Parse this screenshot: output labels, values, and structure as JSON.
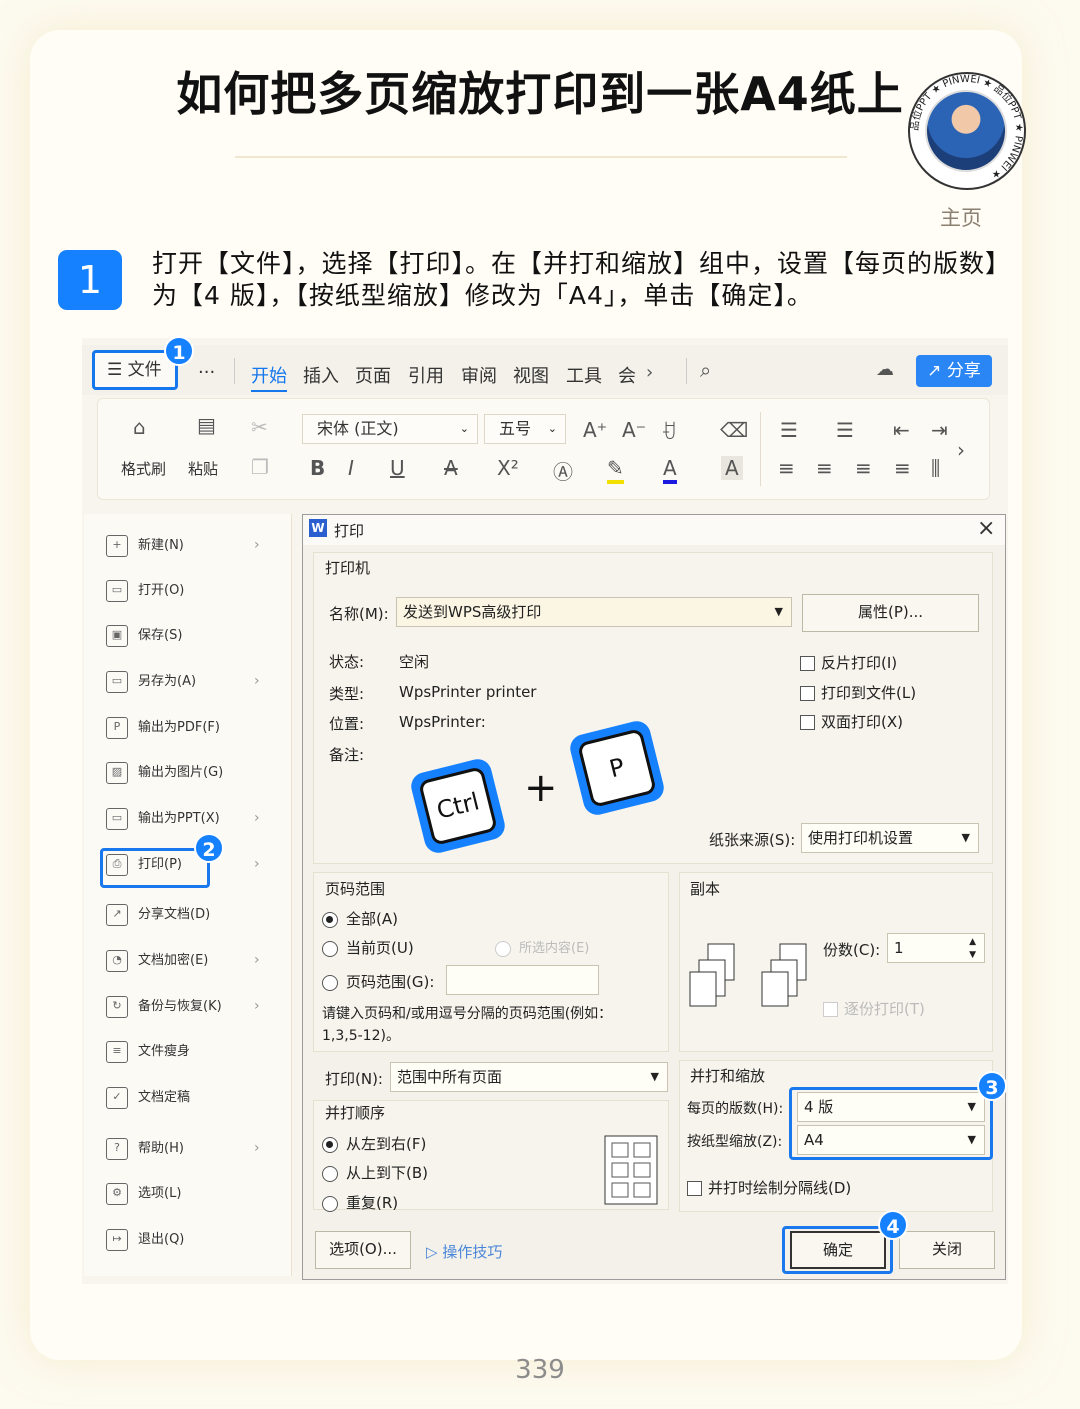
{
  "page": {
    "title": "如何把多页缩放打印到一张A4纸上",
    "home_link": "主页",
    "badge_text": "品位PPT ★ PINWEI ★ 品位PPT ★ PINWEI ★",
    "page_number": "339"
  },
  "step": {
    "number": "1",
    "text": "打开【文件】，选择【打印】。在【并打和缩放】组中，设置【每页的版数】为【4 版】，【按纸型缩放】修改为「A4」，单击【确定】。"
  },
  "app": {
    "file_menu": "文件",
    "more": "···",
    "tabs": [
      "开始",
      "插入",
      "页面",
      "引用",
      "审阅",
      "视图",
      "工具",
      "会"
    ],
    "share": "分享",
    "ribbon": {
      "format_painter": "格式刷",
      "paste": "粘贴",
      "font_name": "宋体 (正文)",
      "font_size": "五号"
    }
  },
  "file_menu_items": [
    {
      "label": "新建(N)",
      "arrow": true
    },
    {
      "label": "打开(O)",
      "arrow": false
    },
    {
      "label": "保存(S)",
      "arrow": false
    },
    {
      "label": "另存为(A)",
      "arrow": true
    },
    {
      "label": "输出为PDF(F)",
      "arrow": false
    },
    {
      "label": "输出为图片(G)",
      "arrow": false
    },
    {
      "label": "输出为PPT(X)",
      "arrow": true
    },
    {
      "label": "打印(P)",
      "arrow": true
    },
    {
      "label": "分享文档(D)",
      "arrow": false
    },
    {
      "label": "文档加密(E)",
      "arrow": true
    },
    {
      "label": "备份与恢复(K)",
      "arrow": true
    },
    {
      "label": "文件瘦身",
      "arrow": false
    },
    {
      "label": "文档定稿",
      "arrow": false
    },
    {
      "label": "帮助(H)",
      "arrow": true
    },
    {
      "label": "选项(L)",
      "arrow": false
    },
    {
      "label": "退出(Q)",
      "arrow": false
    }
  ],
  "dialog": {
    "title": "打印",
    "printer_group": "打印机",
    "name_label": "名称(M):",
    "name_value": "发送到WPS高级打印",
    "properties_btn": "属性(P)...",
    "status_label": "状态:",
    "status_value": "空闲",
    "type_label": "类型:",
    "type_value": "WpsPrinter printer",
    "location_label": "位置:",
    "location_value": "WpsPrinter:",
    "comment_label": "备注:",
    "reverse_print": "反片打印(I)",
    "print_to_file": "打印到文件(L)",
    "duplex": "双面打印(X)",
    "paper_source_label": "纸张来源(S):",
    "paper_source_value": "使用打印机设置",
    "page_range_group": "页码范围",
    "all": "全部(A)",
    "current_page": "当前页(U)",
    "selection": "所选内容(E)",
    "page_range": "页码范围(G):",
    "range_hint": "请键入页码和/或用逗号分隔的页码范围(例如：1,3,5-12)。",
    "copies_group": "副本",
    "copies_label": "份数(C):",
    "copies_value": "1",
    "collate": "逐份打印(T)",
    "print_label": "打印(N):",
    "print_value": "范围中所有页面",
    "order_group": "并打顺序",
    "left_to_right": "从左到右(F)",
    "top_to_bottom": "从上到下(B)",
    "repeat": "重复(R)",
    "zoom_group": "并打和缩放",
    "pages_per_sheet_label": "每页的版数(H):",
    "pages_per_sheet_value": "4 版",
    "scale_label": "按纸型缩放(Z):",
    "scale_value": "A4",
    "draw_separator": "并打时绘制分隔线(D)",
    "options_btn": "选项(O)...",
    "tips_link": "操作技巧",
    "ok_btn": "确定",
    "close_btn": "关闭"
  },
  "shortcut": {
    "key1": "Ctrl",
    "plus": "+",
    "key2": "P"
  },
  "callouts": [
    "1",
    "2",
    "3",
    "4"
  ],
  "colors": {
    "accent": "#1681ff",
    "highlight": "#1a78ee"
  }
}
